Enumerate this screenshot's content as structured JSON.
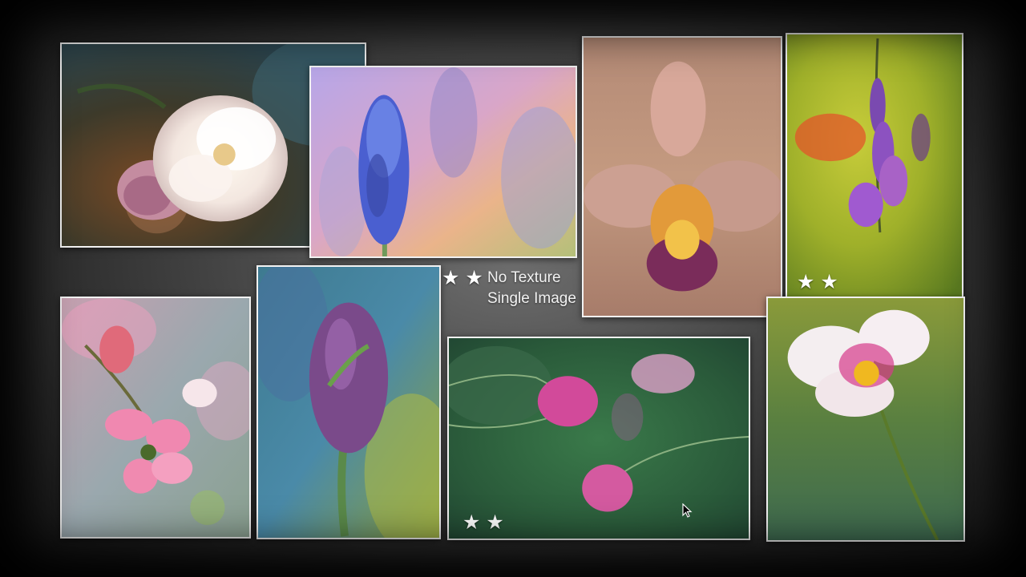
{
  "slide": {
    "caption": {
      "rating_stars": "★ ★",
      "line1": "No Texture",
      "line2": "Single Image"
    },
    "photos": [
      {
        "subject": "white-peony",
        "stars": ""
      },
      {
        "subject": "grape-hyacinth",
        "stars": ""
      },
      {
        "subject": "orchid",
        "stars": ""
      },
      {
        "subject": "angels-fishing-rod",
        "stars": "★ ★"
      },
      {
        "subject": "dogwood",
        "stars": ""
      },
      {
        "subject": "tulip-bud",
        "stars": ""
      },
      {
        "subject": "pink-wildflowers",
        "stars": "★ ★"
      },
      {
        "subject": "cosmos",
        "stars": ""
      }
    ],
    "colors": {
      "frame": "#f2f2f2",
      "star": "#ffffff",
      "background_center": "#6e6e6e",
      "background_edge": "#000000"
    }
  }
}
